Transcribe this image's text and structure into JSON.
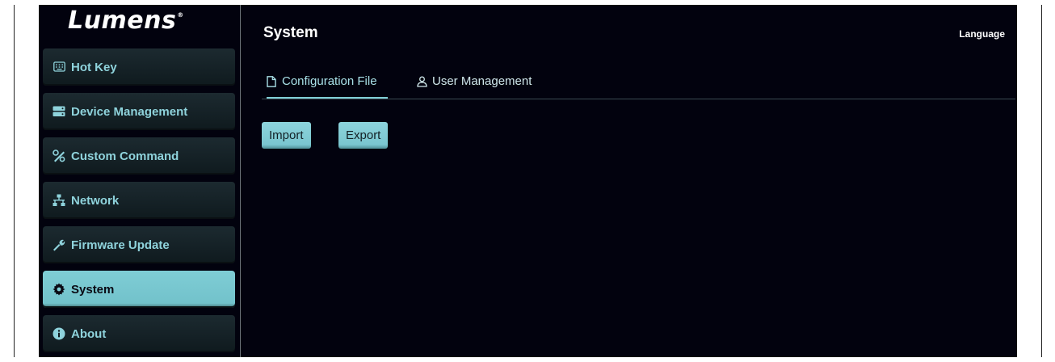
{
  "brand": {
    "logo_text": "Lumens",
    "logo_mark": "®"
  },
  "sidebar": {
    "items": [
      {
        "label": "Hot Key",
        "icon": "keyboard-icon"
      },
      {
        "label": "Device Management",
        "icon": "server-icon"
      },
      {
        "label": "Custom Command",
        "icon": "tools-icon"
      },
      {
        "label": "Network",
        "icon": "network-icon"
      },
      {
        "label": "Firmware Update",
        "icon": "wrench-icon"
      },
      {
        "label": "System",
        "icon": "gear-icon",
        "active": true
      },
      {
        "label": "About",
        "icon": "info-icon"
      }
    ]
  },
  "header": {
    "title": "System",
    "language_label": "Language"
  },
  "tabs": [
    {
      "label": "Configuration File",
      "icon": "file-icon",
      "active": true
    },
    {
      "label": "User Management",
      "icon": "user-icon",
      "active": false
    }
  ],
  "actions": {
    "import_label": "Import",
    "export_label": "Export"
  },
  "colors": {
    "background": "#02020e",
    "accent": "#7fcdd5",
    "sidebar_item_bg": "#1c2a30",
    "sidebar_text": "#8fd3dc"
  }
}
